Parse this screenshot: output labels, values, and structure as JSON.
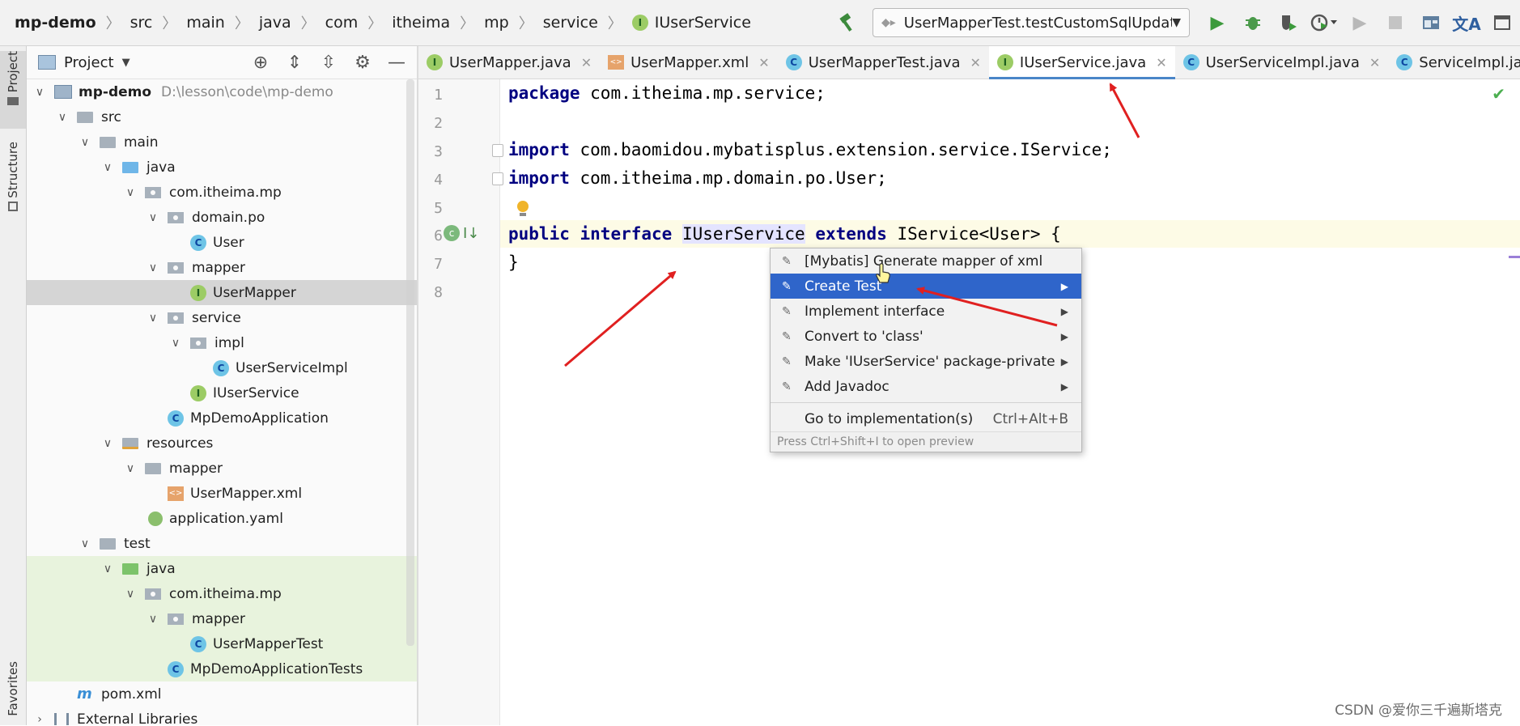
{
  "breadcrumb": [
    "mp-demo",
    "src",
    "main",
    "java",
    "com",
    "itheima",
    "mp",
    "service",
    "IUserService"
  ],
  "run_config": "UserMapperTest.testCustomSqlUpdate",
  "toolbar_icons": [
    "hammer-icon",
    "run-icon",
    "debug-icon",
    "coverage-icon",
    "profile-icon",
    "stop-icon",
    "project-structure-icon",
    "translate-icon"
  ],
  "left_strip": {
    "project": "Project",
    "structure": "Structure",
    "favorites": "Favorites"
  },
  "project_panel": {
    "title": "Project",
    "tree": [
      {
        "label": "mp-demo",
        "path": "D:\\lesson\\code\\mp-demo",
        "type": "module",
        "arrow": "open"
      },
      {
        "label": "src",
        "type": "folder",
        "arrow": "open"
      },
      {
        "label": "main",
        "type": "folder",
        "arrow": "open"
      },
      {
        "label": "java",
        "type": "src-folder",
        "arrow": "open"
      },
      {
        "label": "com.itheima.mp",
        "type": "package",
        "arrow": "open"
      },
      {
        "label": "domain.po",
        "type": "package",
        "arrow": "open"
      },
      {
        "label": "User",
        "type": "class"
      },
      {
        "label": "mapper",
        "type": "package",
        "arrow": "open"
      },
      {
        "label": "UserMapper",
        "type": "interface",
        "selected": true
      },
      {
        "label": "service",
        "type": "package",
        "arrow": "open"
      },
      {
        "label": "impl",
        "type": "package",
        "arrow": "open"
      },
      {
        "label": "UserServiceImpl",
        "type": "class"
      },
      {
        "label": "IUserService",
        "type": "interface"
      },
      {
        "label": "MpDemoApplication",
        "type": "app-class"
      },
      {
        "label": "resources",
        "type": "res-folder",
        "arrow": "open"
      },
      {
        "label": "mapper",
        "type": "folder",
        "arrow": "open"
      },
      {
        "label": "UserMapper.xml",
        "type": "xml"
      },
      {
        "label": "application.yaml",
        "type": "yaml"
      },
      {
        "label": "test",
        "type": "folder",
        "arrow": "open"
      },
      {
        "label": "java",
        "type": "test-folder",
        "arrow": "open"
      },
      {
        "label": "com.itheima.mp",
        "type": "package",
        "arrow": "open"
      },
      {
        "label": "mapper",
        "type": "package",
        "arrow": "open"
      },
      {
        "label": "UserMapperTest",
        "type": "test-class"
      },
      {
        "label": "MpDemoApplicationTests",
        "type": "test-class"
      },
      {
        "label": "pom.xml",
        "type": "maven"
      },
      {
        "label": "External Libraries",
        "type": "library",
        "arrow": "closed"
      }
    ]
  },
  "tabs": [
    {
      "label": "UserMapper.java",
      "icon": "interface"
    },
    {
      "label": "UserMapper.xml",
      "icon": "xml"
    },
    {
      "label": "UserMapperTest.java",
      "icon": "test-class"
    },
    {
      "label": "IUserService.java",
      "icon": "interface",
      "active": true
    },
    {
      "label": "UserServiceImpl.java",
      "icon": "class"
    },
    {
      "label": "ServiceImpl.java",
      "icon": "class"
    }
  ],
  "code": {
    "line_numbers": [
      "1",
      "2",
      "3",
      "4",
      "5",
      "6",
      "7",
      "8"
    ],
    "l1_kw": "package",
    "l1_rest": " com.itheima.mp.service;",
    "l3_kw": "import",
    "l3_rest": " com.baomidou.mybatisplus.extension.service.IService;",
    "l4_kw": "import",
    "l4_rest": " com.itheima.mp.domain.po.User;",
    "l6_kw1": "public",
    "l6_kw2": "interface",
    "l6_ident": "IUserService",
    "l6_kw3": "extends",
    "l6_rest": " IService<User> {",
    "l7": "}"
  },
  "context_menu": {
    "items": [
      {
        "label": "[Mybatis] Generate mapper of xml",
        "submenu": false
      },
      {
        "label": "Create Test",
        "submenu": true,
        "selected": true
      },
      {
        "label": "Implement interface",
        "submenu": true
      },
      {
        "label": "Convert to 'class'",
        "submenu": true
      },
      {
        "label": "Make 'IUserService' package-private",
        "submenu": true
      },
      {
        "label": "Add Javadoc",
        "submenu": true
      }
    ],
    "goto_label": "Go to implementation(s)",
    "goto_shortcut": "Ctrl+Alt+B",
    "hint": "Press Ctrl+Shift+I to open preview"
  },
  "annotation_color": "#e02020",
  "watermark": "CSDN @爱你三千遍斯塔克"
}
